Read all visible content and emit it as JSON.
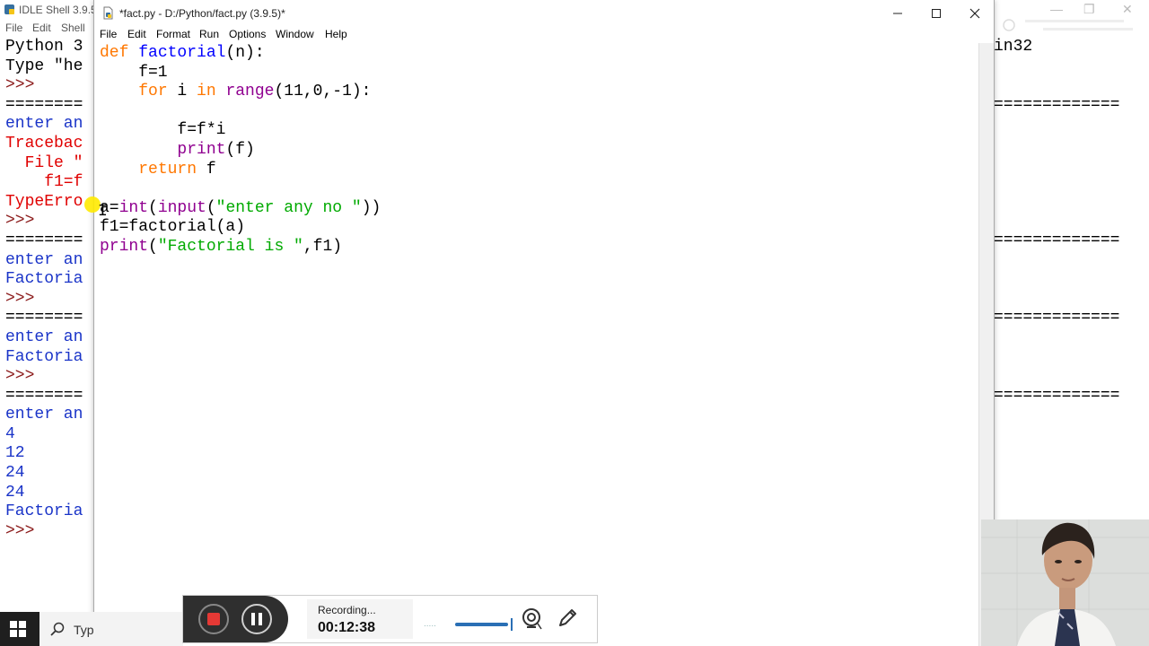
{
  "shell": {
    "title": "IDLE Shell 3.9.5",
    "menu": [
      "File",
      "Edit",
      "Shell"
    ],
    "lines": [
      {
        "text": "Python 3",
        "cls": ""
      },
      {
        "text": "Type \"he",
        "cls": ""
      },
      {
        "text": ">>>",
        "cls": "prompt"
      },
      {
        "text": "========",
        "cls": ""
      },
      {
        "text": "enter an",
        "cls": "blue"
      },
      {
        "text": "Tracebac",
        "cls": "red"
      },
      {
        "text": "  File \"",
        "cls": "red"
      },
      {
        "text": "    f1=f",
        "cls": "red"
      },
      {
        "text": "TypeErro",
        "cls": "red"
      },
      {
        "text": ">>>",
        "cls": "prompt"
      },
      {
        "text": "========",
        "cls": ""
      },
      {
        "text": "enter an",
        "cls": "blue"
      },
      {
        "text": "Factoria",
        "cls": "blue"
      },
      {
        "text": ">>>",
        "cls": "prompt"
      },
      {
        "text": "========",
        "cls": ""
      },
      {
        "text": "enter an",
        "cls": "blue"
      },
      {
        "text": "Factoria",
        "cls": "blue"
      },
      {
        "text": ">>>",
        "cls": "prompt"
      },
      {
        "text": "========",
        "cls": ""
      },
      {
        "text": "enter an",
        "cls": "blue"
      },
      {
        "text": "4",
        "cls": "blue"
      },
      {
        "text": "12",
        "cls": "blue"
      },
      {
        "text": "24",
        "cls": "blue"
      },
      {
        "text": "24",
        "cls": "blue"
      },
      {
        "text": "Factoria",
        "cls": "blue"
      },
      {
        "text": ">>>",
        "cls": "prompt"
      }
    ],
    "right_lines": [
      "in32",
      "",
      "",
      "=============",
      "",
      "",
      "",
      "",
      "",
      "",
      "=============",
      "",
      "",
      "",
      "=============",
      "",
      "",
      "",
      "============="
    ]
  },
  "editor": {
    "title": "*fact.py - D:/Python/fact.py (3.9.5)*",
    "menu": [
      "File",
      "Edit",
      "Format",
      "Run",
      "Options",
      "Window",
      "Help"
    ],
    "code": [
      [
        [
          "def",
          "kw"
        ],
        [
          " ",
          ""
        ],
        [
          "factorial",
          "def"
        ],
        [
          "(n):",
          ""
        ]
      ],
      [
        [
          "    f=1",
          ""
        ]
      ],
      [
        [
          "    ",
          ""
        ],
        [
          "for",
          "kw"
        ],
        [
          " i ",
          ""
        ],
        [
          "in",
          "kw"
        ],
        [
          " ",
          ""
        ],
        [
          "range",
          "bi"
        ],
        [
          "(11,0,-1):",
          ""
        ]
      ],
      [
        [
          "",
          ""
        ]
      ],
      [
        [
          "        f=f*i",
          ""
        ]
      ],
      [
        [
          "        ",
          ""
        ],
        [
          "print",
          "bi"
        ],
        [
          "(f)",
          ""
        ]
      ],
      [
        [
          "    ",
          ""
        ],
        [
          "return",
          "kw"
        ],
        [
          " f",
          ""
        ]
      ],
      [
        [
          "",
          ""
        ]
      ],
      [
        [
          "a=",
          ""
        ],
        [
          "int",
          "bi"
        ],
        [
          "(",
          ""
        ],
        [
          "input",
          "bi"
        ],
        [
          "(",
          ""
        ],
        [
          "\"enter any no \"",
          "str"
        ],
        [
          "))",
          ""
        ]
      ],
      [
        [
          "f1=factorial(a)",
          ""
        ]
      ],
      [
        [
          "print",
          "bi"
        ],
        [
          "(",
          ""
        ],
        [
          "\"Factorial is \"",
          "str"
        ],
        [
          ",f1)",
          ""
        ]
      ]
    ]
  },
  "taskbar": {
    "search_text": "Typ"
  },
  "recorder": {
    "status": "Recording...",
    "timer": "00:12:38",
    "dots": ".....",
    "level": 0.95,
    "accent": "#e53935"
  }
}
